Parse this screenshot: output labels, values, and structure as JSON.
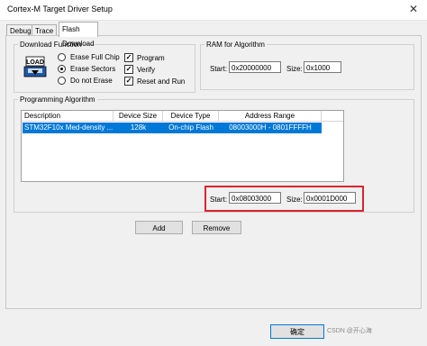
{
  "window": {
    "title": "Cortex-M Target Driver Setup",
    "close_glyph": "✕"
  },
  "tabs": [
    {
      "label": "Debug"
    },
    {
      "label": "Trace"
    },
    {
      "label": "Flash Download"
    }
  ],
  "download_function": {
    "legend": "Download Function",
    "icon_text": "LOAD",
    "options": [
      {
        "label": "Erase Full Chip",
        "selected": false
      },
      {
        "label": "Erase Sectors",
        "selected": true
      },
      {
        "label": "Do not Erase",
        "selected": false
      }
    ],
    "checks": [
      {
        "label": "Program",
        "checked": true
      },
      {
        "label": "Verify",
        "checked": true
      },
      {
        "label": "Reset and Run",
        "checked": true
      }
    ],
    "check_glyph": "✓"
  },
  "ram": {
    "legend": "RAM for Algorithm",
    "start_label": "Start:",
    "start_value": "0x20000000",
    "size_label": "Size:",
    "size_value": "0x1000"
  },
  "programming": {
    "legend": "Programming Algorithm",
    "columns": [
      "Description",
      "Device Size",
      "Device Type",
      "Address Range"
    ],
    "rows": [
      {
        "description": "STM32F10x Med-density ...",
        "size": "128k",
        "type": "On-chip Flash",
        "range": "08003000H - 0801FFFFH"
      }
    ],
    "start_label": "Start:",
    "start_value": "0x08003000",
    "size_label": "Size:",
    "size_value": "0x0001D000"
  },
  "buttons": {
    "add": "Add",
    "remove": "Remove"
  },
  "footer": {
    "ok": "确定",
    "watermark": "CSDN @开心海"
  },
  "colors": {
    "selection": "#0078d7",
    "highlight_border": "#d9262c"
  }
}
